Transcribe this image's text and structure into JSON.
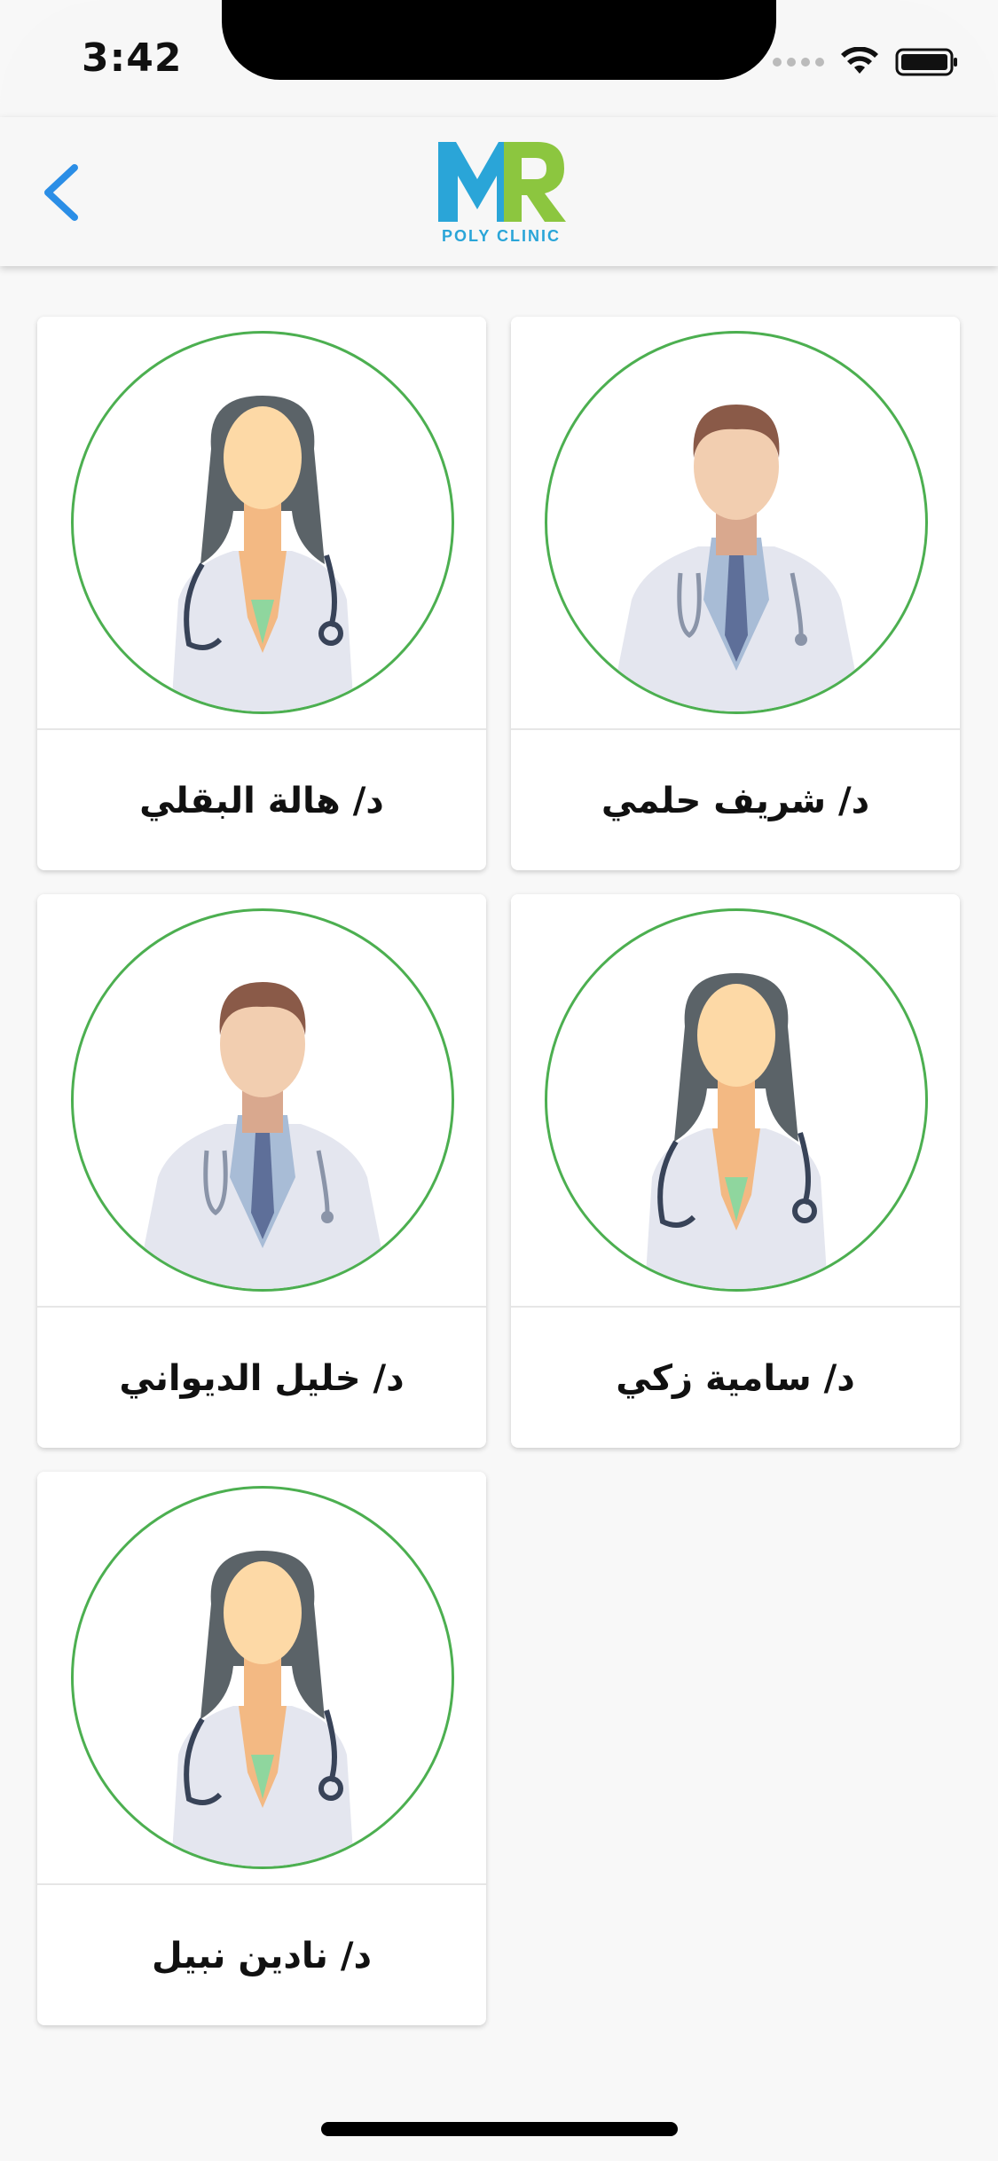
{
  "status_bar": {
    "time": "3:42"
  },
  "nav": {
    "back_icon": "chevron-left-icon",
    "logo_text": "MR",
    "logo_subtitle": "POLY CLINIC"
  },
  "colors": {
    "accent_blue": "#2b8ee6",
    "logo_blue": "#2aa5d8",
    "logo_green": "#8cc63f",
    "avatar_ring": "#4caf50"
  },
  "doctors": [
    {
      "name": "د/ شريف حلمي",
      "avatar": "male-doctor-icon"
    },
    {
      "name": "د/ هالة البقلي",
      "avatar": "female-doctor-icon"
    },
    {
      "name": "د/ سامية زكي",
      "avatar": "female-doctor-icon"
    },
    {
      "name": "د/ خليل الديواني",
      "avatar": "male-doctor-icon"
    },
    {
      "name": "د/ نادين نبيل",
      "avatar": "female-doctor-icon"
    }
  ]
}
